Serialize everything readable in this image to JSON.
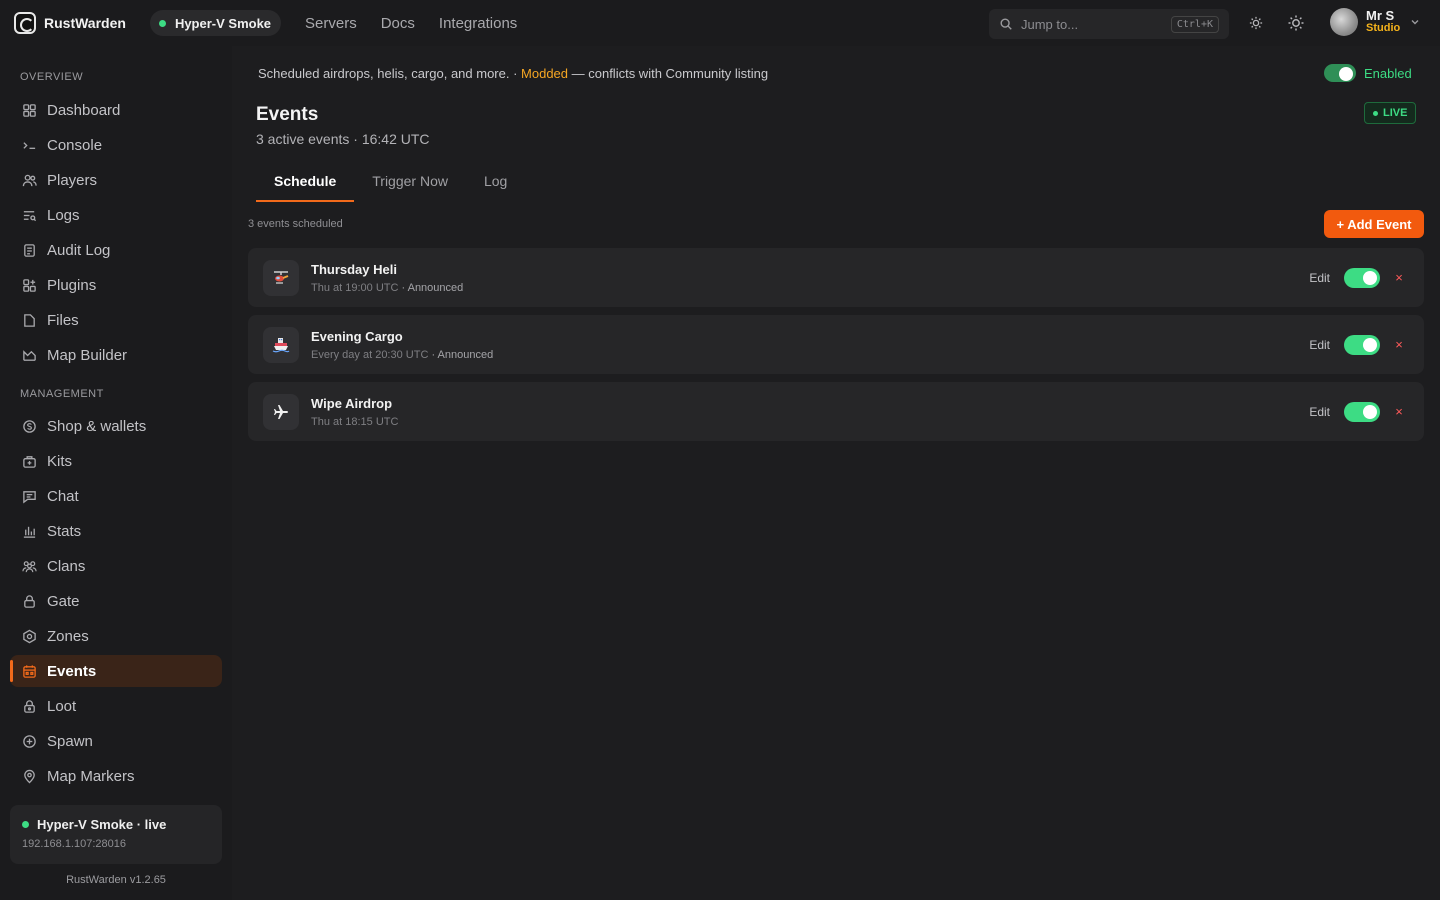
{
  "topbar": {
    "brand": "RustWarden",
    "server_name": "Hyper-V Smoke",
    "nav": [
      "Servers",
      "Docs",
      "Integrations"
    ],
    "search_placeholder": "Jump to...",
    "search_shortcut": "Ctrl+K",
    "user_name": "Mr S",
    "user_role": "Studio"
  },
  "sidebar": {
    "overview_title": "OVERVIEW",
    "overview_items": [
      {
        "label": "Dashboard",
        "icon": "grid-icon"
      },
      {
        "label": "Console",
        "icon": "terminal-icon"
      },
      {
        "label": "Players",
        "icon": "users-icon"
      },
      {
        "label": "Logs",
        "icon": "logs-icon"
      },
      {
        "label": "Audit Log",
        "icon": "audit-icon"
      },
      {
        "label": "Plugins",
        "icon": "plugins-icon"
      },
      {
        "label": "Files",
        "icon": "file-icon"
      },
      {
        "label": "Map Builder",
        "icon": "map-icon"
      }
    ],
    "management_title": "MANAGEMENT",
    "management_items": [
      {
        "label": "Shop & wallets",
        "icon": "coin-icon"
      },
      {
        "label": "Kits",
        "icon": "kit-icon"
      },
      {
        "label": "Chat",
        "icon": "chat-icon"
      },
      {
        "label": "Stats",
        "icon": "stats-icon"
      },
      {
        "label": "Clans",
        "icon": "clans-icon"
      },
      {
        "label": "Gate",
        "icon": "lock-icon"
      },
      {
        "label": "Zones",
        "icon": "zone-icon"
      },
      {
        "label": "Events",
        "icon": "calendar-icon"
      },
      {
        "label": "Loot",
        "icon": "loot-icon"
      },
      {
        "label": "Spawn",
        "icon": "spawn-icon"
      },
      {
        "label": "Map Markers",
        "icon": "pin-icon"
      }
    ],
    "active": "Events",
    "server_card_title": "Hyper-V Smoke · live",
    "server_card_ip": "192.168.1.107:28016",
    "version": "RustWarden v1.2.65"
  },
  "main": {
    "banner_text": "Scheduled airdrops, helis, cargo, and more. · ",
    "banner_modded": "Modded",
    "banner_suffix": " — conflicts with Community listing",
    "enabled_label": "Enabled",
    "title": "Events",
    "subtitle": "3 active events · 16:42 UTC",
    "live_badge": "LIVE",
    "tabs": [
      "Schedule",
      "Trigger Now",
      "Log"
    ],
    "count_label": "3 events scheduled",
    "add_button": "+ Add Event",
    "edit_label": "Edit",
    "delete_label": "×",
    "events": [
      {
        "name": "Thursday Heli",
        "schedule": "Thu at 19:00 UTC",
        "announced": " · Announced",
        "icon": "helicopter-icon",
        "enabled": true
      },
      {
        "name": "Evening Cargo",
        "schedule": "Every day at 20:30 UTC",
        "announced": " · Announced",
        "icon": "ship-icon",
        "enabled": true
      },
      {
        "name": "Wipe Airdrop",
        "schedule": "Thu at 18:15 UTC",
        "announced": "",
        "icon": "airplane-icon",
        "enabled": true
      }
    ]
  },
  "colors": {
    "accent": "#f26a1b",
    "success": "#3ddc84",
    "warning": "#f5a623",
    "danger": "#ff5a5a"
  }
}
